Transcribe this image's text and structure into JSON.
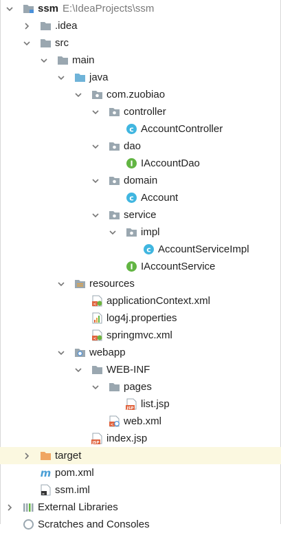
{
  "project": {
    "name": "ssm",
    "path": "E:\\IdeaProjects\\ssm"
  },
  "nodes": {
    "idea": ".idea",
    "src": "src",
    "main": "main",
    "java": "java",
    "package": "com.zuobiao",
    "controller": "controller",
    "account_controller": "AccountController",
    "dao": "dao",
    "iaccount_dao": "IAccountDao",
    "domain": "domain",
    "account": "Account",
    "service": "service",
    "impl": "impl",
    "account_service_impl": "AccountServiceImpl",
    "iaccount_service": "IAccountService",
    "resources": "resources",
    "application_context": "applicationContext.xml",
    "log4j": "log4j.properties",
    "springmvc": "springmvc.xml",
    "webapp": "webapp",
    "web_inf": "WEB-INF",
    "pages": "pages",
    "list_jsp": "list.jsp",
    "web_xml": "web.xml",
    "index_jsp": "index.jsp",
    "target": "target",
    "pom": "pom.xml",
    "ssm_iml": "ssm.iml",
    "external_libraries": "External Libraries",
    "scratches": "Scratches and Consoles"
  },
  "colors": {
    "folder": "#9aa7b0",
    "source_folder": "#6fb3d8",
    "excluded_folder": "#f0a662",
    "class_icon": "#40b6e0",
    "interface_icon": "#62b543",
    "highlight_row": "#fbf8e0"
  }
}
